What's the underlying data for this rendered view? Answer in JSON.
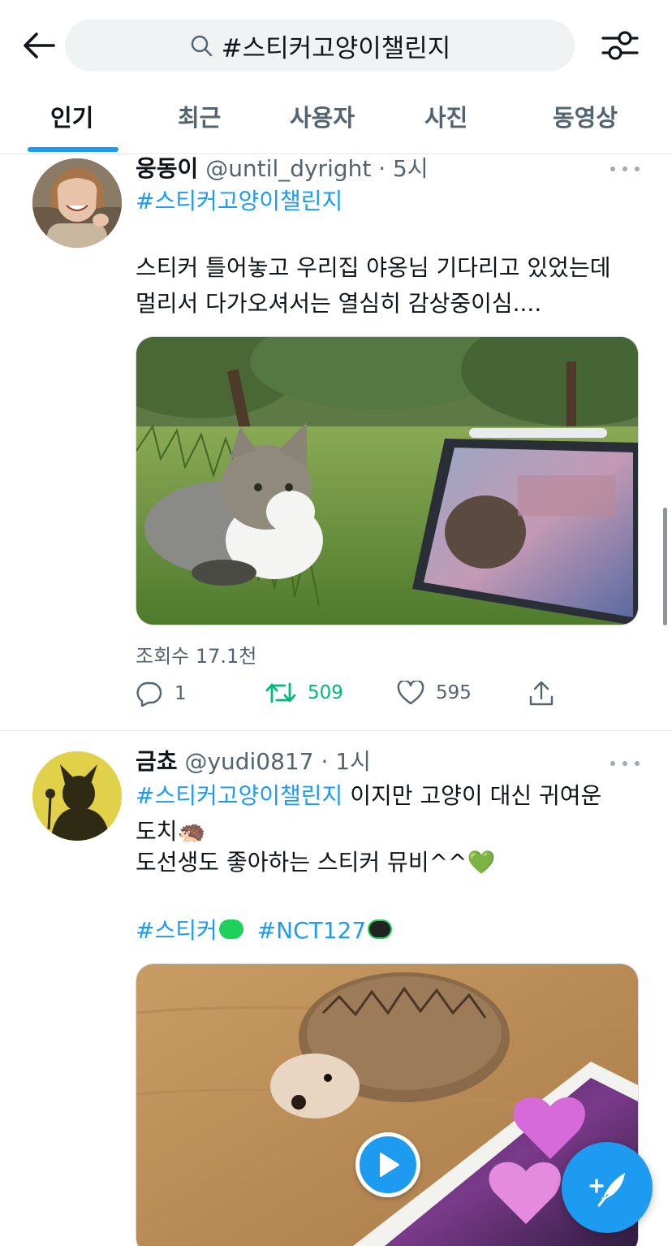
{
  "header": {
    "search_query": "#스티커고양이챌린지"
  },
  "tabs": [
    {
      "label": "인기",
      "active": true
    },
    {
      "label": "최근",
      "active": false
    },
    {
      "label": "사용자",
      "active": false
    },
    {
      "label": "사진",
      "active": false
    },
    {
      "label": "동영상",
      "active": false
    }
  ],
  "tweets": [
    {
      "name": "웅동이",
      "handle": "@until_dyright · 5시",
      "hashtag_line": "#스티커고양이챌린지",
      "body": [
        "스티커 틀어놓고 우리집 야옹님 기다리고 있었는데",
        "멀리서 다가오셔서는 열심히 감상중이심...."
      ],
      "views": "조회수 17.1천",
      "replies": "1",
      "retweets": "509",
      "likes": "595"
    },
    {
      "name": "금쵸",
      "handle": "@yudi0817 · 1시",
      "hashtag": "#스티커고양이챌린지",
      "line1_rest": " 이지만 고양이 대신 귀여운",
      "line2": "도치🦔",
      "line3": "도선생도 좋아하는 스티커 뮤비^^💚",
      "tag1": "#스티커",
      "tag2": "#NCT127"
    }
  ],
  "colors": {
    "accent": "#1d9bf0",
    "retweet": "#00ba7c",
    "secondary_text": "#536471"
  }
}
